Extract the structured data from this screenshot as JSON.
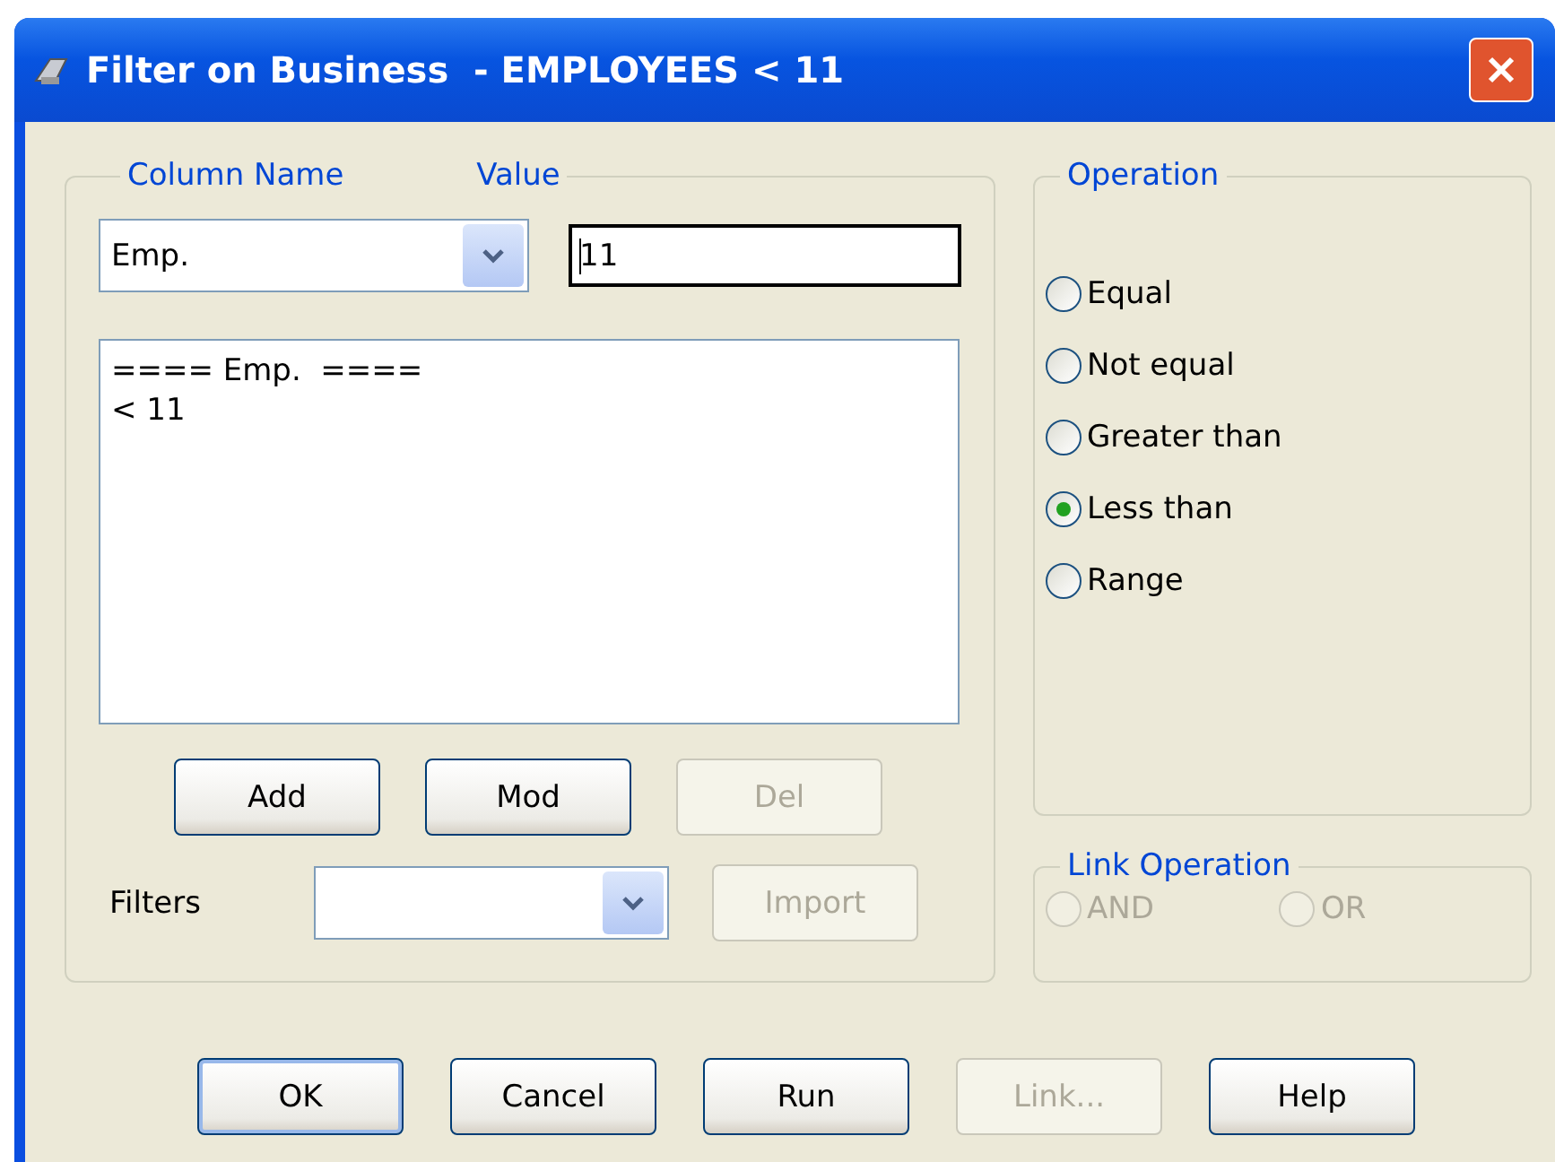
{
  "window": {
    "title": "Filter on Business  - EMPLOYEES < 11"
  },
  "criteria": {
    "column_label": "Column Name",
    "value_label": "Value",
    "column": "Emp.",
    "value": "11",
    "list_lines": [
      "==== Emp.  ====",
      "< 11"
    ],
    "buttons": [
      {
        "label": "Add",
        "disabled": false
      },
      {
        "label": "Mod",
        "disabled": false
      },
      {
        "label": "Del",
        "disabled": true
      }
    ],
    "filters_label": "Filters",
    "import_button": {
      "label": "Import",
      "disabled": true
    }
  },
  "operation": {
    "label": "Operation",
    "options": [
      {
        "label": "Equal",
        "selected": false
      },
      {
        "label": "Not equal",
        "selected": false
      },
      {
        "label": "Greater than",
        "selected": false
      },
      {
        "label": "Less than",
        "selected": true
      },
      {
        "label": "Range",
        "selected": false
      }
    ]
  },
  "link_operation": {
    "label": "Link Operation",
    "disabled": true,
    "options": [
      {
        "label": "AND",
        "selected": false
      },
      {
        "label": "OR",
        "selected": false
      }
    ]
  },
  "buttons": [
    {
      "label": "OK",
      "disabled": false,
      "default": true
    },
    {
      "label": "Cancel",
      "disabled": false,
      "default": false
    },
    {
      "label": "Run",
      "disabled": false,
      "default": false
    },
    {
      "label": "Link...",
      "disabled": true,
      "default": false
    },
    {
      "label": "Help",
      "disabled": false,
      "default": false
    }
  ]
}
